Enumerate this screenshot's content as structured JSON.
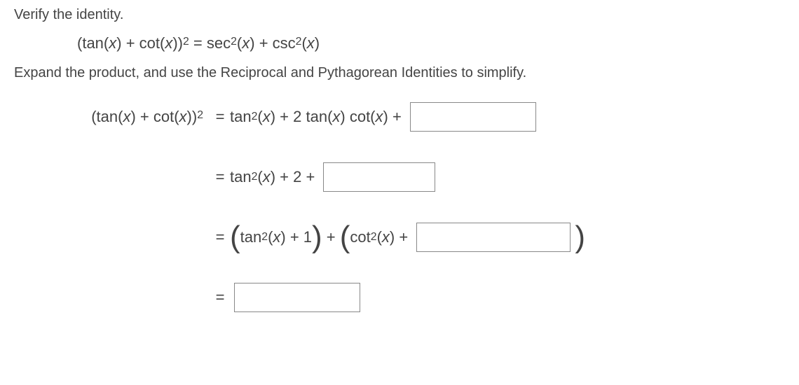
{
  "prompt": {
    "line1": "Verify the identity.",
    "identity_pre": "(tan(",
    "identity_x1": "x",
    "identity_mid1": ") + cot(",
    "identity_x2": "x",
    "identity_mid2": "))",
    "identity_sq": "2",
    "identity_eq": " = sec",
    "identity_sec_sq": "2",
    "identity_sec_open": "(",
    "identity_x3": "x",
    "identity_sec_close": ") + csc",
    "identity_csc_sq": "2",
    "identity_csc_open": "(",
    "identity_x4": "x",
    "identity_csc_close": ")",
    "line3": "Expand the product, and use the Reciprocal and Pythagorean Identities to simplify."
  },
  "steps": {
    "lhs_pre": "(tan(",
    "lhs_x1": "x",
    "lhs_mid": ") + cot(",
    "lhs_x2": "x",
    "lhs_post": "))",
    "lhs_sq": "2",
    "eq": "=",
    "r1_a": "tan",
    "r1_sq": "2",
    "r1_open": "(",
    "r1_x": "x",
    "r1_close": ") + 2 tan(",
    "r1_x2": "x",
    "r1_mid": ") cot(",
    "r1_x3": "x",
    "r1_end": ") + ",
    "r2_a": "tan",
    "r2_sq": "2",
    "r2_open": "(",
    "r2_x": "x",
    "r2_close": ") + 2 + ",
    "r3_tan": "tan",
    "r3_tan_sq": "2",
    "r3_tan_open": "(",
    "r3_x1": "x",
    "r3_tan_close": ") + 1",
    "r3_plus": " + ",
    "r3_cot": "cot",
    "r3_cot_sq": "2",
    "r3_cot_open": "(",
    "r3_x2": "x",
    "r3_cot_close": ") + "
  }
}
